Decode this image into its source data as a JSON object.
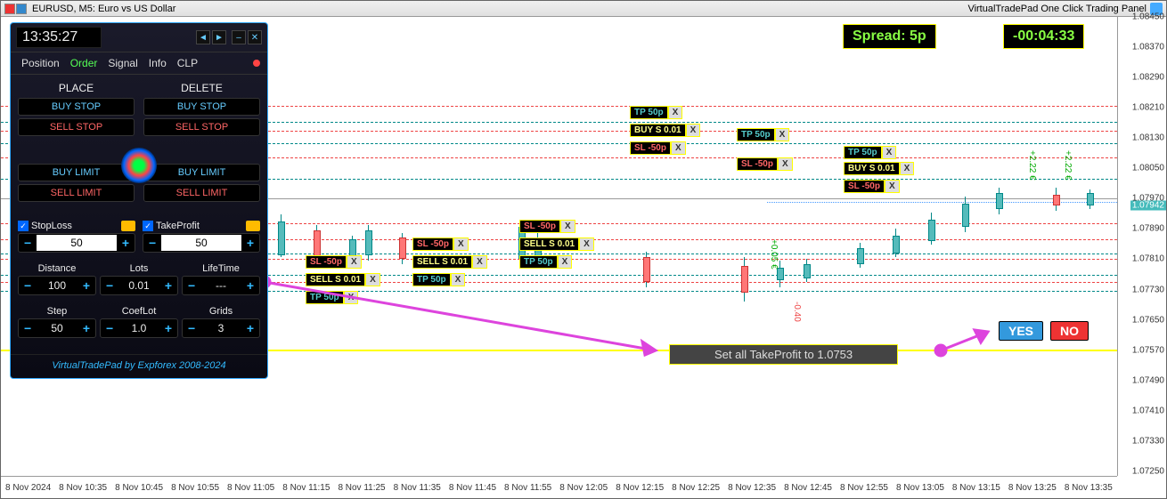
{
  "titlebar": {
    "symbol": "EURUSD, M5: Euro vs US Dollar",
    "right_label": "VirtualTradePad One Click Trading Panel"
  },
  "spread": "Spread: 5p",
  "timer": "-00:04:33",
  "price_axis": {
    "ticks": [
      "1.08450",
      "1.08370",
      "1.08290",
      "1.08210",
      "1.08130",
      "1.08050",
      "1.07970",
      "1.07890",
      "1.07810",
      "1.07730",
      "1.07650",
      "1.07570",
      "1.07490",
      "1.07410",
      "1.07330",
      "1.07250"
    ],
    "current": "1.07942"
  },
  "time_axis": [
    "8 Nov 2024",
    "8 Nov 10:35",
    "8 Nov 10:45",
    "8 Nov 10:55",
    "8 Nov 11:05",
    "8 Nov 11:15",
    "8 Nov 11:25",
    "8 Nov 11:35",
    "8 Nov 11:45",
    "8 Nov 11:55",
    "8 Nov 12:05",
    "8 Nov 12:15",
    "8 Nov 12:25",
    "8 Nov 12:35",
    "8 Nov 12:45",
    "8 Nov 12:55",
    "8 Nov 13:05",
    "8 Nov 13:15",
    "8 Nov 13:25",
    "8 Nov 13:35"
  ],
  "confirm": {
    "message": "Set all  TakeProfit to 1.0753",
    "yes": "YES",
    "no": "NO"
  },
  "panel": {
    "time": "13:35:27",
    "tabs": {
      "position": "Position",
      "order": "Order",
      "signal": "Signal",
      "info": "Info",
      "clp": "CLP"
    },
    "cols": {
      "place": "PLACE",
      "delete": "DELETE",
      "buystop": "BUY STOP",
      "sellstop": "SELL STOP",
      "buylimit": "BUY LIMIT",
      "selllimit": "SELL LIMIT"
    },
    "sltp": {
      "sl_label": "StopLoss",
      "tp_label": "TakeProfit",
      "sl_val": "50",
      "tp_val": "50"
    },
    "params1": {
      "distance": {
        "label": "Distance",
        "val": "100"
      },
      "lots": {
        "label": "Lots",
        "val": "0.01"
      },
      "lifetime": {
        "label": "LifeTime",
        "val": "---"
      }
    },
    "params2": {
      "step": {
        "label": "Step",
        "val": "50"
      },
      "coeflot": {
        "label": "CoefLot",
        "val": "1.0"
      },
      "grids": {
        "label": "Grids",
        "val": "3"
      }
    },
    "footer": "VirtualTradePad by Expforex 2008-2024"
  },
  "tags": {
    "tp50": "TP 50p",
    "sl50": "SL -50p",
    "buys": "BUY S 0.01",
    "sells": "SELL S 0.01",
    "x": "X"
  },
  "annot": {
    "p222a": "+2.22 €",
    "p222b": "+2.22 €",
    "p005": "+0.05 €",
    "m040": "-0.40"
  }
}
